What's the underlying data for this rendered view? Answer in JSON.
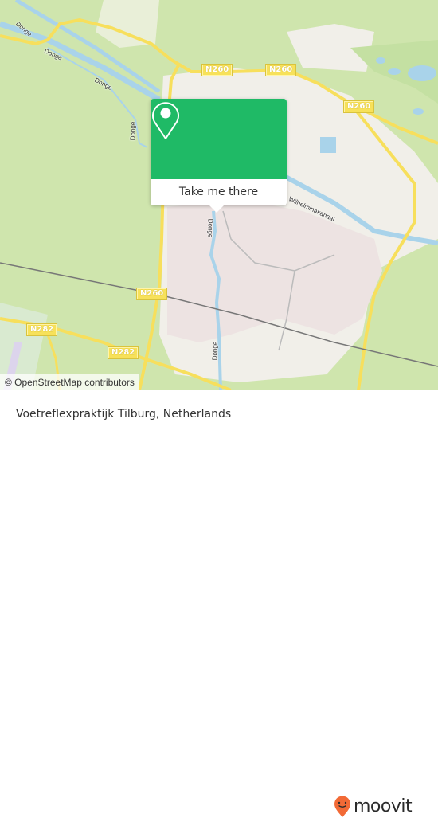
{
  "map": {
    "road_labels": [
      {
        "id": "n260-top-left",
        "text": "N260"
      },
      {
        "id": "n260-top-mid",
        "text": "N260"
      },
      {
        "id": "n260-right",
        "text": "N260"
      },
      {
        "id": "n260-mid",
        "text": "N260"
      },
      {
        "id": "n282-left",
        "text": "N282"
      },
      {
        "id": "n282-bottom",
        "text": "N282"
      }
    ],
    "water_labels": [
      {
        "id": "donge-1",
        "text": "Donge"
      },
      {
        "id": "donge-2",
        "text": "Donge"
      },
      {
        "id": "donge-3",
        "text": "Donge"
      },
      {
        "id": "donge-4",
        "text": "Donge"
      },
      {
        "id": "donge-5",
        "text": "Donge"
      },
      {
        "id": "donge-6",
        "text": "Donge"
      },
      {
        "id": "wilhelminakanaal",
        "text": "Wilhelminakanaal"
      }
    ],
    "attribution": "© OpenStreetMap contributors",
    "colors": {
      "farmland": "#cfe5ad",
      "urban": "#efe7e6",
      "water": "#a9d3ea",
      "road": "#f7df5c",
      "rail": "#777777"
    }
  },
  "popup": {
    "icon": "map-pin-icon",
    "button_label": "Take me there",
    "accent_color": "#1fba66"
  },
  "footer": {
    "place_name": "Voetreflexpraktijk Tilburg, Netherlands",
    "brand": "moovit",
    "brand_color": "#f26a36"
  }
}
